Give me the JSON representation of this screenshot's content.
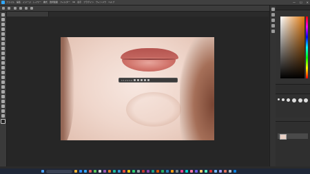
{
  "app": {
    "name": "Photoshop"
  },
  "menus": [
    "ファイル",
    "編集",
    "イメージ",
    "レイヤー",
    "書式",
    "選択範囲",
    "フィルター",
    "3D",
    "表示",
    "プラグイン",
    "ウィンドウ",
    "ヘルプ"
  ],
  "window_controls": [
    "—",
    "☐",
    "✕"
  ],
  "document": {
    "tab_title": ""
  },
  "context_bar": {
    "label": "1 1 2 2 1 2"
  },
  "colors": {
    "accent": "#31a8ff",
    "panel_bg": "#323232",
    "workspace_bg": "#262626"
  },
  "icons": [
    "ps-logo-icon",
    "move-tool-icon",
    "marquee-tool-icon",
    "lasso-tool-icon",
    "brush-tool-icon",
    "eraser-tool-icon",
    "zoom-tool-icon",
    "search-icon",
    "windows-start-icon"
  ]
}
